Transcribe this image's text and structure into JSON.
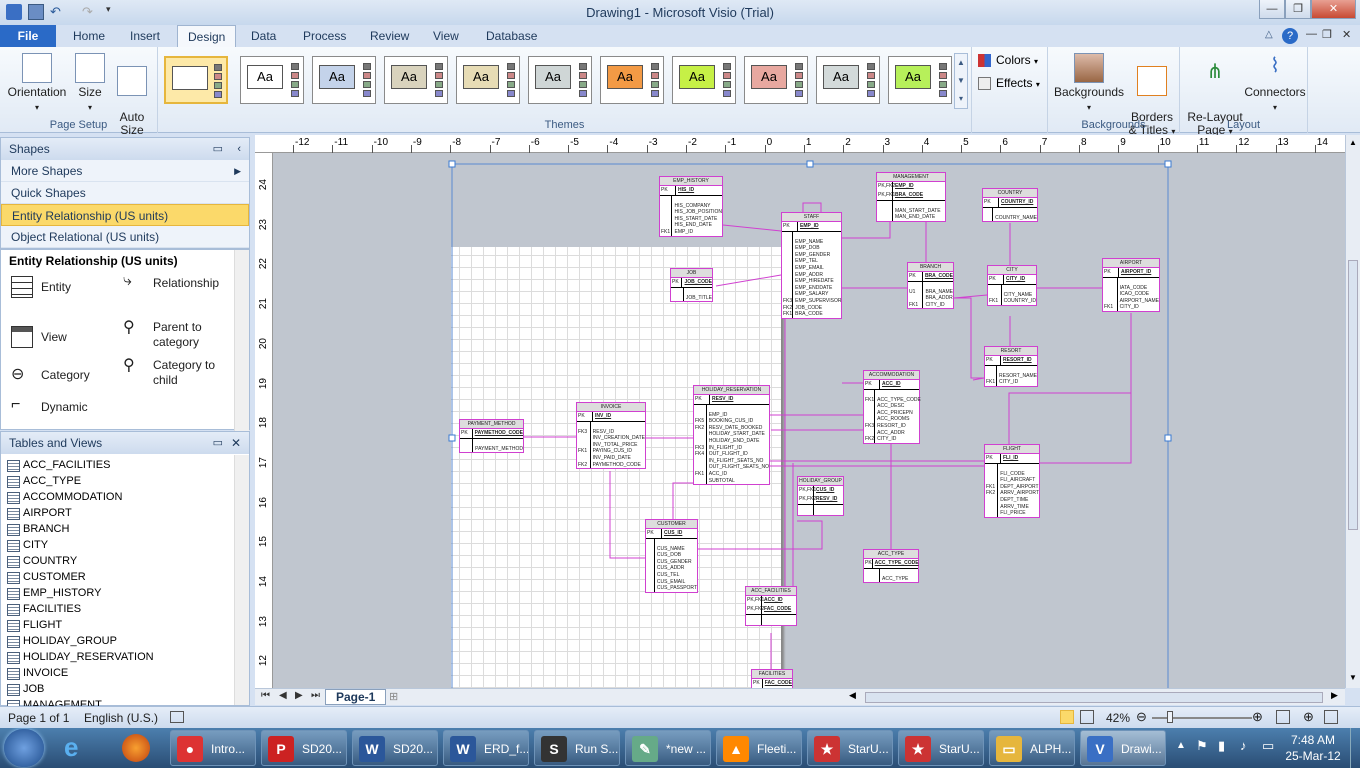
{
  "window": {
    "title": "Drawing1  -  Microsoft Visio (Trial)"
  },
  "tabs": [
    "File",
    "Home",
    "Insert",
    "Design",
    "Data",
    "Process",
    "Review",
    "View",
    "Database"
  ],
  "active_tab": "Design",
  "ribbon": {
    "page_setup": {
      "label": "Page Setup",
      "buttons": [
        "Orientation",
        "Size",
        "Auto\nSize"
      ]
    },
    "themes": {
      "label": "Themes",
      "count": 11,
      "sample": "Aa",
      "colors": [
        "#ffffff",
        "#ffffff",
        "#c4d3ea",
        "#d9d3bd",
        "#e7dcb5",
        "#cfd6d6",
        "#f39a45",
        "#c6f046",
        "#e8a8a0",
        "#d3dada",
        "#b7f05a"
      ]
    },
    "colors_label": "Colors",
    "effects_label": "Effects",
    "backgrounds": {
      "label": "Backgrounds",
      "buttons": [
        "Backgrounds",
        "Borders\n& Titles"
      ]
    },
    "layout": {
      "label": "Layout",
      "buttons": [
        "Re-Layout\nPage",
        "Connectors"
      ]
    }
  },
  "shapes_panel": {
    "title": "Shapes",
    "items": [
      "More Shapes",
      "Quick Shapes",
      "Entity Relationship (US units)",
      "Object Relational (US units)"
    ],
    "selected": "Entity Relationship (US units)",
    "stencil_title": "Entity Relationship (US units)",
    "stencils": [
      "Entity",
      "Relationship",
      "View",
      "Parent to\ncategory",
      "Category",
      "Category to\nchild",
      "Dynamic"
    ]
  },
  "tables_panel": {
    "title": "Tables and Views",
    "items": [
      "ACC_FACILITIES",
      "ACC_TYPE",
      "ACCOMMODATION",
      "AIRPORT",
      "BRANCH",
      "CITY",
      "COUNTRY",
      "CUSTOMER",
      "EMP_HISTORY",
      "FACILITIES",
      "FLIGHT",
      "HOLIDAY_GROUP",
      "HOLIDAY_RESERVATION",
      "INVOICE",
      "JOB",
      "MANAGEMENT"
    ]
  },
  "ruler": {
    "h": [
      "-12",
      "-11",
      "-10",
      "-9",
      "-8",
      "-7",
      "-6",
      "-5",
      "-4",
      "-3",
      "-2",
      "-1",
      "0",
      "1",
      "2",
      "3",
      "4",
      "5",
      "6",
      "7",
      "8",
      "9",
      "10",
      "11",
      "12",
      "13",
      "14"
    ],
    "v": [
      "24",
      "23",
      "22",
      "21",
      "20",
      "19",
      "18",
      "17",
      "16",
      "15",
      "14",
      "13",
      "12"
    ]
  },
  "entities": [
    {
      "name": "EMP_HISTORY",
      "pk": [
        [
          "PK",
          "HIS_ID"
        ]
      ],
      "rows": [
        [
          "",
          ""
        ],
        [
          "",
          "HIS_COMPANY"
        ],
        [
          "",
          "HIS_JOB_POSITION"
        ],
        [
          "",
          "HIS_START_DATE"
        ],
        [
          "",
          "HIS_END_DATE"
        ],
        [
          "FK1",
          "EMP_ID"
        ]
      ]
    },
    {
      "name": "MANAGEMENT",
      "pk": [
        [
          "PK,FK2",
          "EMP_ID"
        ],
        [
          "PK,FK1",
          "BRA_CODE"
        ]
      ],
      "rows": [
        [
          "",
          ""
        ],
        [
          "",
          "MAN_START_DATE"
        ],
        [
          "",
          "MAN_END_DATE"
        ]
      ]
    },
    {
      "name": "COUNTRY",
      "pk": [
        [
          "PK",
          "COUNTRY_ID"
        ]
      ],
      "rows": [
        [
          "",
          ""
        ],
        [
          "",
          "COUNTRY_NAME"
        ]
      ]
    },
    {
      "name": "STAFF",
      "pk": [
        [
          "PK",
          "EMP_ID"
        ]
      ],
      "rows": [
        [
          "",
          ""
        ],
        [
          "",
          "EMP_NAME"
        ],
        [
          "",
          "EMP_DOB"
        ],
        [
          "",
          "EMP_GENDER"
        ],
        [
          "",
          "EMP_TEL"
        ],
        [
          "",
          "EMP_EMAIL"
        ],
        [
          "",
          "EMP_ADDR"
        ],
        [
          "",
          "EMP_HIREDATE"
        ],
        [
          "",
          "EMP_ENDDATE"
        ],
        [
          "",
          "EMP_SALARY"
        ],
        [
          "FK3",
          "EMP_SUPERVISOR"
        ],
        [
          "FK2",
          "JOB_CODE"
        ],
        [
          "FK1",
          "BRA_CODE"
        ]
      ]
    },
    {
      "name": "JOB",
      "pk": [
        [
          "PK",
          "JOB_CODE"
        ]
      ],
      "rows": [
        [
          "",
          ""
        ],
        [
          "",
          "JOB_TITLE"
        ]
      ]
    },
    {
      "name": "BRANCH",
      "pk": [
        [
          "PK",
          "BRA_CODE"
        ]
      ],
      "rows": [
        [
          "",
          ""
        ],
        [
          "U1",
          "BRA_NAME"
        ],
        [
          "",
          "BRA_ADDR"
        ],
        [
          "FK1",
          "CITY_ID"
        ]
      ]
    },
    {
      "name": "CITY",
      "pk": [
        [
          "PK",
          "CITY_ID"
        ]
      ],
      "rows": [
        [
          "",
          ""
        ],
        [
          "",
          "CITY_NAME"
        ],
        [
          "FK1",
          "COUNTRY_ID"
        ]
      ]
    },
    {
      "name": "AIRPORT",
      "pk": [
        [
          "PK",
          "AIRPORT_ID"
        ]
      ],
      "rows": [
        [
          "",
          ""
        ],
        [
          "",
          "IATA_CODE"
        ],
        [
          "",
          "ICAO_CODE"
        ],
        [
          "",
          "AIRPORT_NAME"
        ],
        [
          "FK1",
          "CITY_ID"
        ]
      ]
    },
    {
      "name": "RESORT",
      "pk": [
        [
          "PK",
          "RESORT_ID"
        ]
      ],
      "rows": [
        [
          "",
          ""
        ],
        [
          "",
          "RESORT_NAME"
        ],
        [
          "FK1",
          "CITY_ID"
        ]
      ]
    },
    {
      "name": "ACCOMMODATION",
      "pk": [
        [
          "PK",
          "ACC_ID"
        ]
      ],
      "rows": [
        [
          "",
          ""
        ],
        [
          "FK1",
          "ACC_TYPE_CODE"
        ],
        [
          "",
          "ACC_DESC"
        ],
        [
          "",
          "ACC_PRICEPN"
        ],
        [
          "",
          "ACC_ROOMS"
        ],
        [
          "FK3",
          "RESORT_ID"
        ],
        [
          "",
          "ACC_ADDR"
        ],
        [
          "FK2",
          "CITY_ID"
        ]
      ]
    },
    {
      "name": "HOLIDAY_RESERVATION",
      "pk": [
        [
          "PK",
          "RESV_ID"
        ]
      ],
      "rows": [
        [
          "",
          ""
        ],
        [
          "",
          "EMP_ID"
        ],
        [
          "FK5",
          "BOOKING_CUS_ID"
        ],
        [
          "FK2",
          "RESV_DATE_BOOKED"
        ],
        [
          "",
          "HOLIDAY_START_DATE"
        ],
        [
          "",
          "HOLIDAY_END_DATE"
        ],
        [
          "FK3",
          "IN_FLIGHT_ID"
        ],
        [
          "FK4",
          "OUT_FLIGHT_ID"
        ],
        [
          "",
          "IN_FLIGHT_SEATS_NO"
        ],
        [
          "",
          "OUT_FLIGHT_SEATS_NO"
        ],
        [
          "FK1",
          "ACC_ID"
        ],
        [
          "",
          "SUBTOTAL"
        ]
      ]
    },
    {
      "name": "INVOICE",
      "pk": [
        [
          "PK",
          "INV_ID"
        ]
      ],
      "rows": [
        [
          "",
          ""
        ],
        [
          "FK3",
          "RESV_ID"
        ],
        [
          "",
          "INV_CREATION_DATE"
        ],
        [
          "",
          "INV_TOTAL_PRICE"
        ],
        [
          "FK1",
          "PAYING_CUS_ID"
        ],
        [
          "",
          "INV_PAID_DATE"
        ],
        [
          "FK2",
          "PAYMETHOD_CODE"
        ]
      ]
    },
    {
      "name": "PAYMENT_METHOD",
      "pk": [
        [
          "PK",
          "PAYMETHOD_CODE"
        ]
      ],
      "rows": [
        [
          "",
          ""
        ],
        [
          "",
          "PAYMENT_METHOD"
        ]
      ]
    },
    {
      "name": "FLIGHT",
      "pk": [
        [
          "PK",
          "FLI_ID"
        ]
      ],
      "rows": [
        [
          "",
          ""
        ],
        [
          "",
          "FLI_CODE"
        ],
        [
          "",
          "FLI_AIRCRAFT"
        ],
        [
          "FK1",
          "DEPT_AIRPORT"
        ],
        [
          "FK2",
          "ARRV_AIRPORT"
        ],
        [
          "",
          "DEPT_TIME"
        ],
        [
          "",
          "ARRV_TIME"
        ],
        [
          "",
          "FLI_PRICE"
        ]
      ]
    },
    {
      "name": "HOLIDAY_GROUP",
      "pk": [
        [
          "PK,FK1",
          "CUS_ID"
        ],
        [
          "PK,FK2",
          "RESV_ID"
        ]
      ],
      "rows": []
    },
    {
      "name": "CUSTOMER",
      "pk": [
        [
          "PK",
          "CUS_ID"
        ]
      ],
      "rows": [
        [
          "",
          ""
        ],
        [
          "",
          "CUS_NAME"
        ],
        [
          "",
          "CUS_DOB"
        ],
        [
          "",
          "CUS_GENDER"
        ],
        [
          "",
          "CUS_ADDR"
        ],
        [
          "",
          "CUS_TEL"
        ],
        [
          "",
          "CUS_EMAIL"
        ],
        [
          "",
          "CUS_PASSPORT"
        ]
      ]
    },
    {
      "name": "ACC_TYPE",
      "pk": [
        [
          "PK",
          "ACC_TYPE_CODE"
        ]
      ],
      "rows": [
        [
          "",
          ""
        ],
        [
          "",
          "ACC_TYPE"
        ]
      ]
    },
    {
      "name": "ACC_FACILITIES",
      "pk": [
        [
          "PK,FK1",
          "ACC_ID"
        ],
        [
          "PK,FK2",
          "FAC_CODE"
        ]
      ],
      "rows": []
    },
    {
      "name": "FACILITIES",
      "pk": [
        [
          "PK",
          "FAC_CODE"
        ]
      ],
      "rows": []
    }
  ],
  "page_tab": "Page-1",
  "status": {
    "page": "Page 1 of 1",
    "language": "English (U.S.)",
    "zoom": "42%"
  },
  "taskbar": {
    "items": [
      {
        "label": "Intro...",
        "icon": "chrome",
        "color": "#d33"
      },
      {
        "label": "SD20...",
        "icon": "pdf",
        "color": "#c22"
      },
      {
        "label": "SD20...",
        "icon": "word",
        "color": "#2b579a"
      },
      {
        "label": "ERD_f...",
        "icon": "word",
        "color": "#2b579a"
      },
      {
        "label": "Run S...",
        "icon": "sql",
        "color": "#333"
      },
      {
        "label": "*new ...",
        "icon": "notepad",
        "color": "#6a8"
      },
      {
        "label": "Fleeti...",
        "icon": "vlc",
        "color": "#f80"
      },
      {
        "label": "StarU...",
        "icon": "star",
        "color": "#c33"
      },
      {
        "label": "StarU...",
        "icon": "star",
        "color": "#c33"
      },
      {
        "label": "ALPH...",
        "icon": "folder",
        "color": "#e6b63d"
      },
      {
        "label": "Drawi...",
        "icon": "visio",
        "color": "#3a6fc4"
      }
    ],
    "time": "7:48 AM",
    "date": "25-Mar-12"
  }
}
